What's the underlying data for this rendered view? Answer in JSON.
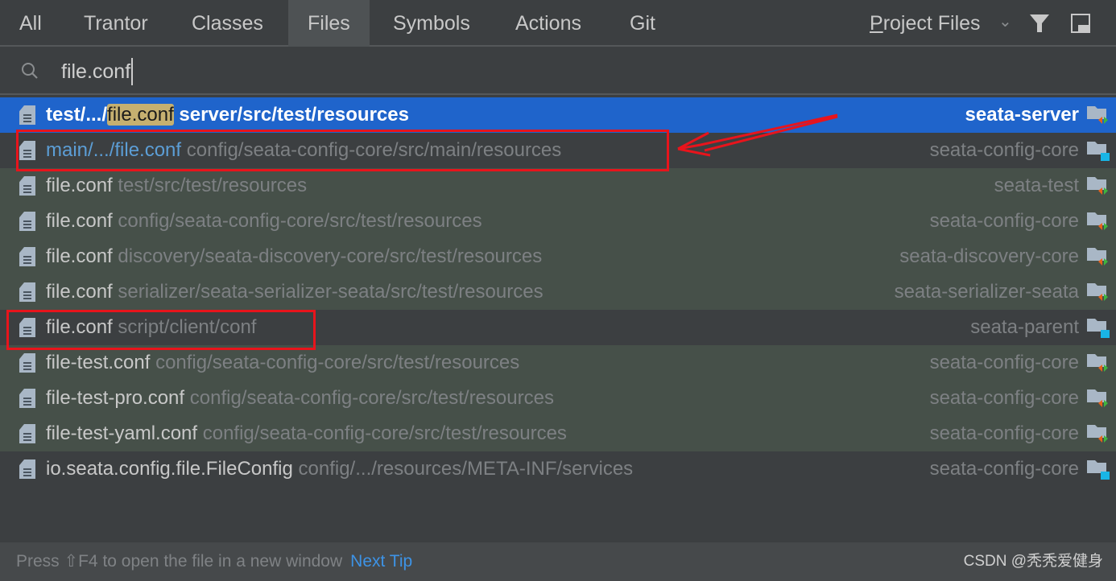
{
  "tabs": [
    {
      "label": "All"
    },
    {
      "label": "Trantor"
    },
    {
      "label": "Classes"
    },
    {
      "label": "Files",
      "selected": true
    },
    {
      "label": "Symbols"
    },
    {
      "label": "Actions"
    },
    {
      "label": "Git"
    }
  ],
  "scope": {
    "mnemonic": "P",
    "rest": "roject Files"
  },
  "search": {
    "value": "file.conf"
  },
  "results": [
    {
      "prefix": "test/.../",
      "match": "file.conf",
      "location": "server/src/test/resources",
      "module": "seata-server",
      "module_type": "test",
      "style": "sel"
    },
    {
      "prefix": "main/.../file.conf",
      "match": "",
      "location": "config/seata-config-core/src/main/resources",
      "module": "seata-config-core",
      "module_type": "main",
      "style": "dark main"
    },
    {
      "prefix": "file.conf",
      "match": "",
      "location": "test/src/test/resources",
      "module": "seata-test",
      "module_type": "test",
      "style": "green"
    },
    {
      "prefix": "file.conf",
      "match": "",
      "location": "config/seata-config-core/src/test/resources",
      "module": "seata-config-core",
      "module_type": "test",
      "style": "green"
    },
    {
      "prefix": "file.conf",
      "match": "",
      "location": "discovery/seata-discovery-core/src/test/resources",
      "module": "seata-discovery-core",
      "module_type": "test",
      "style": "green"
    },
    {
      "prefix": "file.conf",
      "match": "",
      "location": "serializer/seata-serializer-seata/src/test/resources",
      "module": "seata-serializer-seata",
      "module_type": "test",
      "style": "green"
    },
    {
      "prefix": "file.conf",
      "match": "",
      "location": "script/client/conf",
      "module": "seata-parent",
      "module_type": "main",
      "style": "dark"
    },
    {
      "prefix": "file-test.conf",
      "match": "",
      "location": "config/seata-config-core/src/test/resources",
      "module": "seata-config-core",
      "module_type": "test",
      "style": "green"
    },
    {
      "prefix": "file-test-pro.conf",
      "match": "",
      "location": "config/seata-config-core/src/test/resources",
      "module": "seata-config-core",
      "module_type": "test",
      "style": "green"
    },
    {
      "prefix": "file-test-yaml.conf",
      "match": "",
      "location": "config/seata-config-core/src/test/resources",
      "module": "seata-config-core",
      "module_type": "test",
      "style": "green"
    },
    {
      "prefix": "io.seata.config.file.FileConfig",
      "match": "",
      "location": "config/.../resources/META-INF/services",
      "module": "seata-config-core",
      "module_type": "main",
      "style": "dark"
    }
  ],
  "footer": {
    "tip": "Press ⇧F4 to open the file in a new window",
    "next_tip": "Next Tip",
    "watermark": "CSDN @秃秃爱健身"
  },
  "colors": {
    "selection": "#1f64cb",
    "test_row": "#465049",
    "annotation": "#e8141c",
    "link": "#3d93e6"
  }
}
